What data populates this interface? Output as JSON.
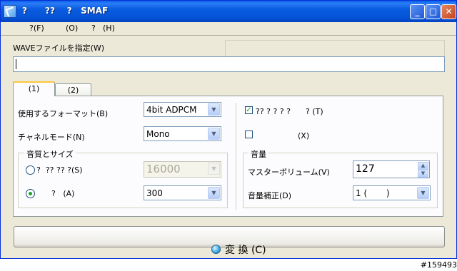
{
  "window": {
    "title": "?      ??    ?   SMAF"
  },
  "menu": [
    {
      "label": "?(F)"
    },
    {
      "label": "(O)"
    },
    {
      "label": "?"
    },
    {
      "label": "(H)"
    }
  ],
  "wave_file": {
    "label": "WAVEファイルを指定(W)",
    "value": ""
  },
  "tabs": [
    {
      "label": "(1)"
    },
    {
      "label": "(2)"
    }
  ],
  "format": {
    "label": "使用するフォーマット(B)",
    "selected": "4bit ADPCM"
  },
  "channel_mode": {
    "label": "チャネルモード(N)",
    "selected": "Mono"
  },
  "quality_size": {
    "legend": "音質とサイズ",
    "option1": {
      "label": "?  ?? ?? ?(S)",
      "value": "16000",
      "selected": false
    },
    "option2": {
      "label": "?   (A)",
      "value": "300",
      "selected": true
    }
  },
  "checkbox1": {
    "label": "?? ? ? ? ?      ? (T)",
    "checked": true
  },
  "checkbox2": {
    "label": "(X)",
    "checked": false
  },
  "volume": {
    "legend": "音量",
    "master_label": "マスターボリューム(V)",
    "master_value": "127",
    "correction_label": "音量補正(D)",
    "correction_selected": "1 (       )"
  },
  "convert_button": {
    "label": "変 換 (C)"
  },
  "watermark": "#159493"
}
